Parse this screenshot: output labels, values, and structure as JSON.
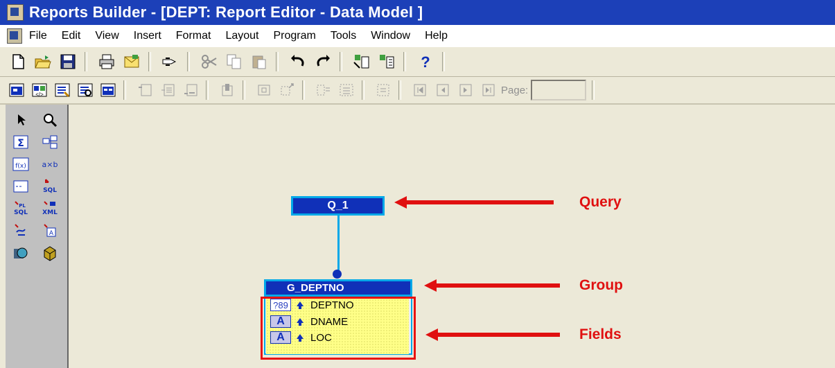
{
  "window": {
    "title": "Reports Builder - [DEPT: Report Editor - Data Model ]"
  },
  "menu": [
    "File",
    "Edit",
    "View",
    "Insert",
    "Format",
    "Layout",
    "Program",
    "Tools",
    "Window",
    "Help"
  ],
  "toolbar2": {
    "page_label": "Page:",
    "page_value": ""
  },
  "palette": {
    "summary_label": "Σ",
    "formula_label": "f(x)",
    "axb_label": "a×b",
    "sql_label": "SQL",
    "xml_label": "XML"
  },
  "data_model": {
    "query": {
      "name": "Q_1"
    },
    "group": {
      "name": "G_DEPTNO"
    },
    "fields": [
      {
        "name": "DEPTNO",
        "type_icon": "?89",
        "kind": "number"
      },
      {
        "name": "DNAME",
        "type_icon": "A",
        "kind": "char"
      },
      {
        "name": "LOC",
        "type_icon": "A",
        "kind": "char"
      }
    ]
  },
  "annotations": {
    "query": "Query",
    "group": "Group",
    "fields": "Fields",
    "color": "#e01010"
  },
  "colors": {
    "titlebar": "#1c40b8",
    "object_fill": "#1030b8",
    "object_border": "#00a8e8",
    "fields_fill": "#ffff88"
  }
}
